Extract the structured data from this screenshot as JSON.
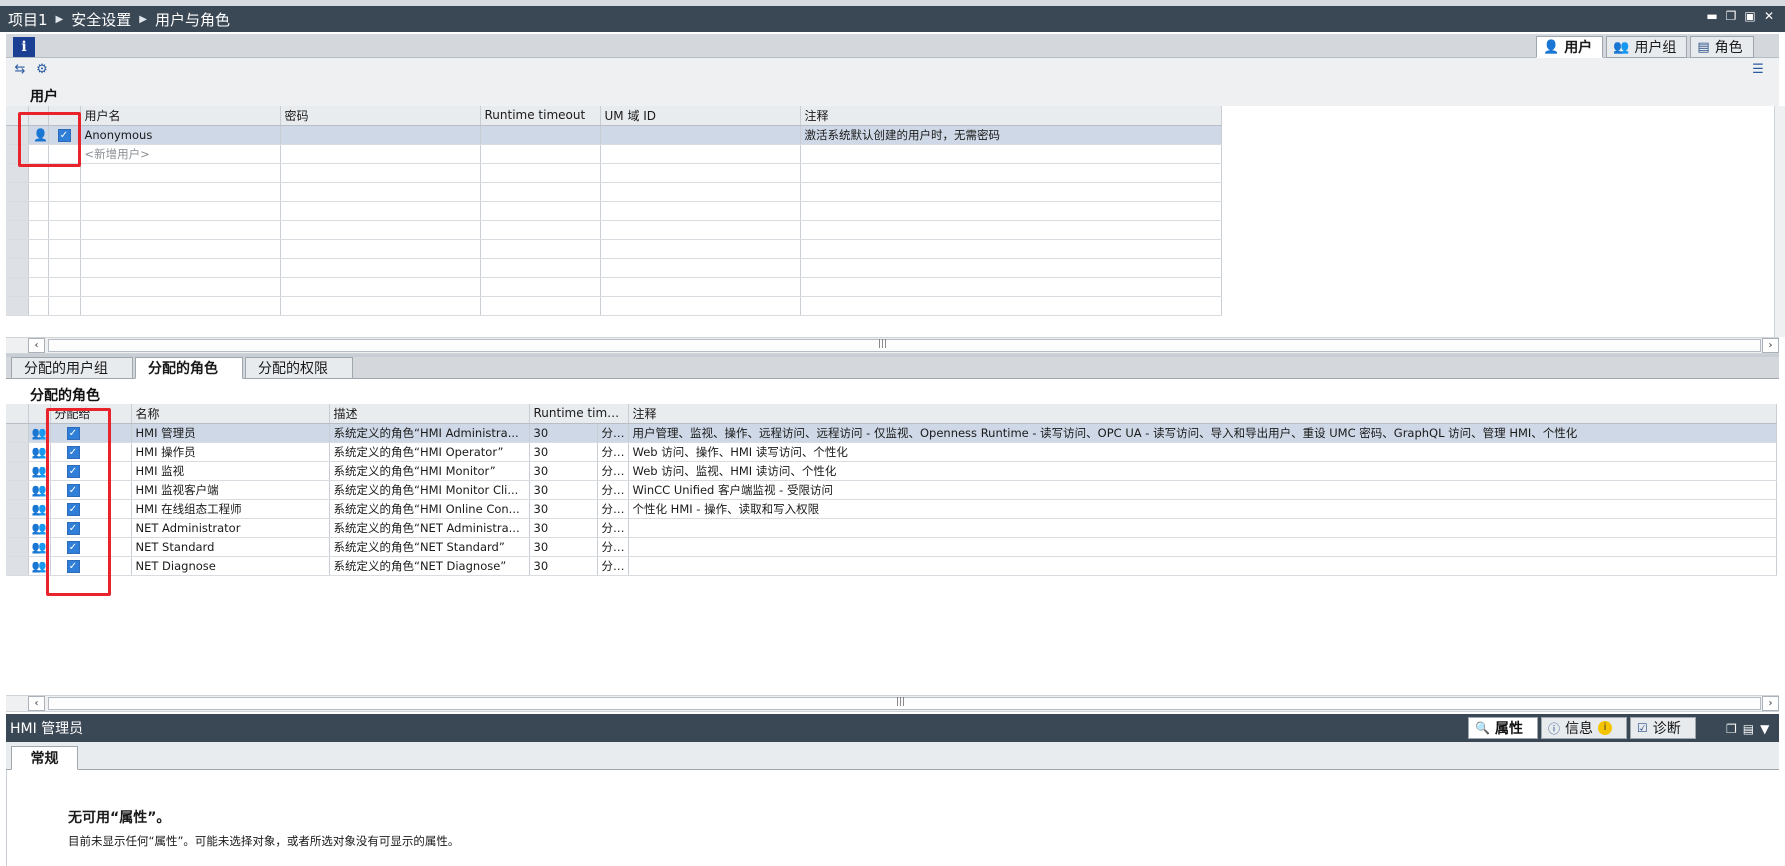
{
  "breadcrumb": [
    "项目1",
    "安全设置",
    "用户与角色"
  ],
  "top_tabs": [
    {
      "label": "用户",
      "icon": "user-icon"
    },
    {
      "label": "用户组",
      "icon": "user-group-icon"
    },
    {
      "label": "角色",
      "icon": "role-icon"
    }
  ],
  "users_section": {
    "title": "用户",
    "columns": [
      "用户名",
      "密码",
      "Runtime timeout",
      "UM 域 ID",
      "注释"
    ],
    "rows": [
      {
        "name": "Anonymous",
        "password": "",
        "runtime_timeout": "",
        "um_domain_id": "",
        "comment": "激活系统默认创建的用户时，无需密码",
        "checked": true
      }
    ],
    "new_row_placeholder": "<新增用户>"
  },
  "bottom_tabs": [
    "分配的用户组",
    "分配的角色",
    "分配的权限"
  ],
  "roles_section": {
    "title": "分配的角色",
    "columns": [
      "分配给",
      "名称",
      "描述",
      "Runtime timeout",
      "注释"
    ],
    "rows": [
      {
        "assigned": true,
        "name": "HMI 管理员",
        "desc": "系统定义的角色“HMI Administra...",
        "timeout": "30",
        "unit": "分钟",
        "comment": "用户管理、监视、操作、远程访问、远程访问 - 仅监视、Openness Runtime - 读写访问、OPC UA - 读写访问、导入和导出用户、重设 UMC 密码、GraphQL 访问、管理 HMI、个性化"
      },
      {
        "assigned": true,
        "name": "HMI 操作员",
        "desc": "系统定义的角色“HMI Operator”",
        "timeout": "30",
        "unit": "分钟",
        "comment": "Web 访问、操作、HMI 读写访问、个性化"
      },
      {
        "assigned": true,
        "name": "HMI 监视",
        "desc": "系统定义的角色“HMI Monitor”",
        "timeout": "30",
        "unit": "分钟",
        "comment": "Web 访问、监视、HMI 读访问、个性化"
      },
      {
        "assigned": true,
        "name": "HMI 监视客户端",
        "desc": "系统定义的角色“HMI Monitor Cli...",
        "timeout": "30",
        "unit": "分钟",
        "comment": "WinCC Unified 客户端监视 - 受限访问"
      },
      {
        "assigned": true,
        "name": "HMI 在线组态工程师",
        "desc": "系统定义的角色“HMI Online Con...",
        "timeout": "30",
        "unit": "分钟",
        "comment": "个性化 HMI - 操作、读取和写入权限"
      },
      {
        "assigned": true,
        "name": "NET Administrator",
        "desc": "系统定义的角色“NET Administra...",
        "timeout": "30",
        "unit": "分钟",
        "comment": ""
      },
      {
        "assigned": true,
        "name": "NET Standard",
        "desc": "系统定义的角色“NET Standard”",
        "timeout": "30",
        "unit": "分钟",
        "comment": ""
      },
      {
        "assigned": true,
        "name": "NET Diagnose",
        "desc": "系统定义的角色“NET Diagnose”",
        "timeout": "30",
        "unit": "分钟",
        "comment": ""
      }
    ]
  },
  "inspector": {
    "title": "HMI 管理员",
    "tabs": [
      {
        "label": "属性",
        "icon": "properties-icon"
      },
      {
        "label": "信息",
        "icon": "info-icon"
      },
      {
        "label": "诊断",
        "icon": "diagnostics-icon"
      }
    ],
    "general_tab": "常规",
    "message_title": "无可用“属性”。",
    "message_body": "目前未显示任何“属性”。可能未选择对象，或者所选对象没有可显示的属性。"
  }
}
